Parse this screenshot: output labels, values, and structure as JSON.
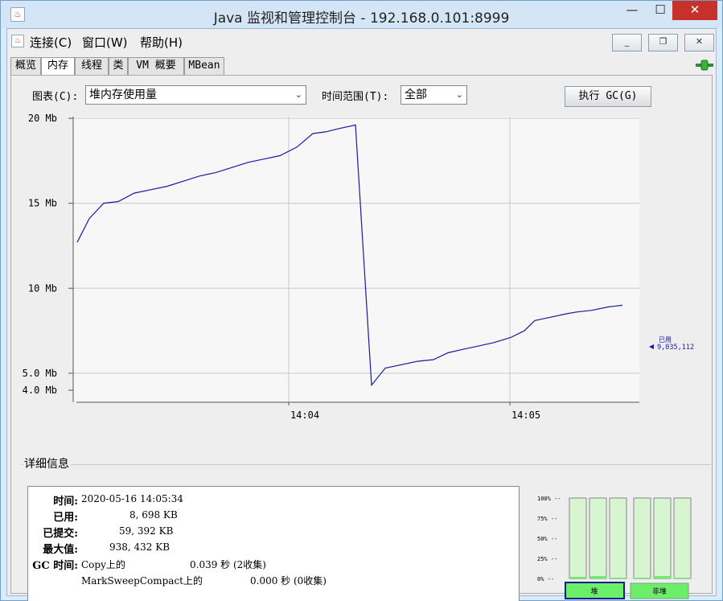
{
  "window": {
    "title": "Java 监视和管理控制台 - 192.168.0.101:8999",
    "app_icon": "java-cup-icon",
    "minimize_glyph": "—",
    "maximize_glyph": "☐",
    "close_glyph": "✕"
  },
  "menu": {
    "items": [
      "连接(C)",
      "窗口(W)",
      "帮助(H)"
    ],
    "inner_min_glyph": "_",
    "inner_restore_glyph": "❐",
    "inner_close_glyph": "✕"
  },
  "tabs": [
    "概览",
    "内存",
    "线程",
    "类",
    "VM 概要",
    "MBean"
  ],
  "active_tab": "内存",
  "toolbar": {
    "chart_label": "图表(C):",
    "chart_value": "堆内存使用量",
    "time_label": "时间范围(T):",
    "time_value": "全部",
    "gc_button": "执行 GC(G)"
  },
  "chart_data": {
    "type": "line",
    "y_ticks": [
      "20 Mb",
      "15 Mb",
      "10 Mb",
      "5.0 Mb",
      "4.0 Mb"
    ],
    "x_ticks": [
      "14:04",
      "14:05"
    ],
    "series": [
      {
        "name": "已用",
        "color": "#1a1aa0",
        "y_mb": [
          12.7,
          14.1,
          15.0,
          15.1,
          15.6,
          15.8,
          16.0,
          16.3,
          16.6,
          16.8,
          17.1,
          17.4,
          17.6,
          17.8,
          18.3,
          19.1,
          19.2,
          19.4,
          19.6,
          4.3,
          5.3,
          5.5,
          5.7,
          5.8,
          6.2,
          6.4,
          6.6,
          6.8,
          7.1,
          7.5,
          8.1,
          8.3,
          8.5,
          8.6,
          8.7,
          8.9,
          9.0
        ],
        "x_fraction_is_index": true
      }
    ],
    "current_label": "已用",
    "current_value": "9,035,112",
    "ylim_mb": [
      4.0,
      20.0
    ],
    "grid": true
  },
  "details": {
    "title": "详细信息",
    "rows": [
      {
        "key": "时间:",
        "value": "2020-05-16 14:05:34"
      },
      {
        "key": "已用:",
        "value": "8, 698 KB"
      },
      {
        "key": "已提交:",
        "value": "59, 392 KB"
      },
      {
        "key": "最大值:",
        "value": "938, 432 KB"
      },
      {
        "key": "GC 时间:",
        "value": "Copy上的"
      }
    ],
    "gc_copy_time": "0.039 秒 (2收集)",
    "gc_msc_label": "MarkSweepCompact上的",
    "gc_msc_time": "0.000 秒 (0收集)"
  },
  "pools": {
    "percent_labels": [
      "100% --",
      "75% --",
      "50% --",
      "25% --",
      "0% --"
    ],
    "heap_label": "堆",
    "nonheap_label": "非堆",
    "heap_bars": [
      0.02,
      0.03,
      0.01
    ],
    "nonheap_bars": [
      0.0,
      0.03,
      0.01
    ],
    "heap_color": "#6bef6b",
    "bar_bg": "#d6f5d0"
  }
}
